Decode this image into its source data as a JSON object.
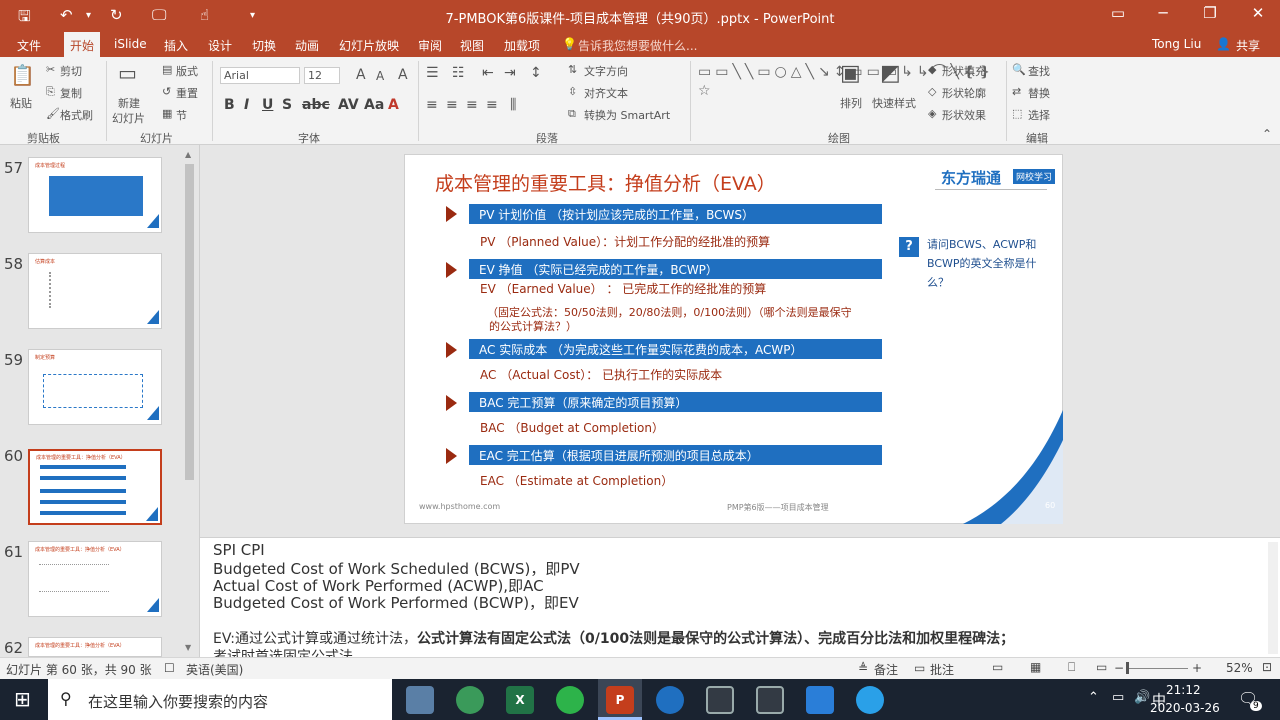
{
  "window": {
    "title": "7-PMBOK第6版课件-项目成本管理（共90页）.pptx - PowerPoint",
    "controls": [
      "▭",
      "─",
      "❐",
      "✕"
    ]
  },
  "tabs": [
    "文件",
    "开始",
    "iSlide",
    "插入",
    "设计",
    "切换",
    "动画",
    "幻灯片放映",
    "审阅",
    "视图",
    "加载项"
  ],
  "tell_me": "告诉我您想要做什么...",
  "user": "Tong Liu",
  "share": "共享",
  "ribbon": {
    "paste": "粘贴",
    "cut": "剪切",
    "copy": "复制",
    "format_painter": "格式刷",
    "new_slide": "新建",
    "new_slide2": "幻灯片",
    "layout": "版式",
    "reset": "重置",
    "section": "节",
    "font_name": "Arial",
    "font_size": "12",
    "text_direction": "文字方向",
    "align_text": "对齐文本",
    "smartart": "转换为 SmartArt",
    "arrange": "排列",
    "quick_styles": "快速样式",
    "shape_fill": "形状填充",
    "shape_outline": "形状轮廓",
    "shape_effects": "形状效果",
    "find": "查找",
    "replace": "替换",
    "select": "选择",
    "groups": [
      "剪贴板",
      "幻灯片",
      "字体",
      "段落",
      "绘图",
      "编辑"
    ]
  },
  "thumbnails": [
    {
      "num": "57",
      "title": "成本管理过程"
    },
    {
      "num": "58",
      "title": "估算成本"
    },
    {
      "num": "59",
      "title": "制定预算"
    },
    {
      "num": "60",
      "title": "成本管理的重要工具：挣值分析（EVA）"
    },
    {
      "num": "61",
      "title": "成本管理的重要工具：挣值分析（EVA）"
    },
    {
      "num": "62",
      "title": "成本管理的重要工具：挣值分析（EVA）"
    }
  ],
  "slide": {
    "title": "成本管理的重要工具：挣值分析（EVA）",
    "logo": "东方瑞通",
    "logo_badge": "网校学习",
    "items": [
      {
        "bar": "PV 计划价值 （按计划应该完成的工作量，BCWS）",
        "detail": "PV （Planned Value）：计划工作分配的经批准的预算"
      },
      {
        "bar": "EV 挣值 （实际已经完成的工作量，BCWP）",
        "detail": "EV （Earned Value） ： 已完成工作的经批准的预算"
      },
      {
        "bar": "AC 实际成本 （为完成这些工作量实际花费的成本，ACWP）",
        "detail": "AC （Actual Cost）： 已执行工作的实际成本"
      },
      {
        "bar": "BAC 完工预算（原来确定的项目预算）",
        "detail": "BAC （Budget at Completion）"
      },
      {
        "bar": "EAC 完工估算（根据项目进展所预测的项目总成本）",
        "detail": "EAC （Estimate at Completion）"
      }
    ],
    "formula_note_1": "（固定公式法：50/50法则，20/80法则，0/100法则）（哪个法则是最保守",
    "formula_note_2": "的公式计算法？）",
    "question": "请问BCWS、ACWP和BCWP的英文全称是什么？",
    "footer_url": "www.hpsthome.com",
    "footer_center": "PMP第6版——项目成本管理",
    "page": "60"
  },
  "notes": {
    "line1": "SPI  CPI",
    "line2": "Budgeted Cost of Work Scheduled (BCWS)，即PV",
    "line3": "Actual Cost of Work Performed (ACWP),即AC",
    "line4": "Budgeted Cost of Work Performed (BCWP)，即EV",
    "line5_normal": "EV:通过公式计算或通过统计法，",
    "line5_bold": "公式计算法有固定公式法（0/100法则是最保守的公式计算法）、完成百分比法和加权里程碑法；",
    "line6": "考试时首选固定公式法"
  },
  "status": {
    "slide_count": "幻灯片 第 60 张，共 90 张",
    "language": "英语(美国)",
    "notes_btn": "备注",
    "comments_btn": "批注",
    "zoom": "52%"
  },
  "taskbar": {
    "search_placeholder": "在这里输入你要搜索的内容",
    "time": "21:12",
    "date": "2020-03-26",
    "notify_count": "9",
    "ime": "中"
  }
}
